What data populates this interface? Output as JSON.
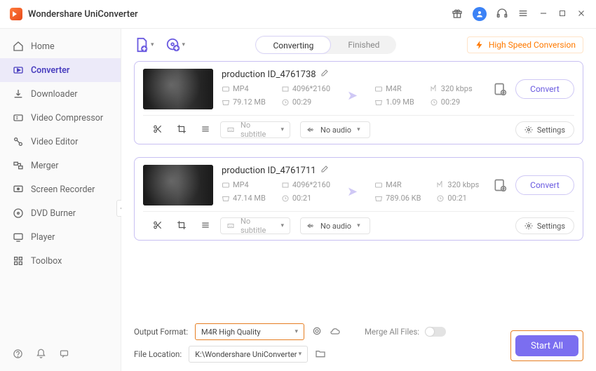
{
  "app": {
    "title": "Wondershare UniConverter"
  },
  "sidebar": {
    "items": [
      {
        "label": "Home"
      },
      {
        "label": "Converter"
      },
      {
        "label": "Downloader"
      },
      {
        "label": "Video Compressor"
      },
      {
        "label": "Video Editor"
      },
      {
        "label": "Merger"
      },
      {
        "label": "Screen Recorder"
      },
      {
        "label": "DVD Burner"
      },
      {
        "label": "Player"
      },
      {
        "label": "Toolbox"
      }
    ]
  },
  "tabs": {
    "converting": "Converting",
    "finished": "Finished"
  },
  "banner": {
    "high_speed": "High Speed Conversion"
  },
  "items": [
    {
      "name": "production ID_4761738",
      "src_fmt": "MP4",
      "src_res": "4096*2160",
      "src_size": "79.12 MB",
      "src_dur": "00:29",
      "dst_fmt": "M4R",
      "dst_kbps": "320 kbps",
      "dst_size": "1.09 MB",
      "dst_dur": "00:29",
      "subtitle": "No subtitle",
      "audio": "No audio",
      "convert_label": "Convert",
      "settings_label": "Settings"
    },
    {
      "name": "production ID_4761711",
      "src_fmt": "MP4",
      "src_res": "4096*2160",
      "src_size": "47.14 MB",
      "src_dur": "00:21",
      "dst_fmt": "M4R",
      "dst_kbps": "320 kbps",
      "dst_size": "789.06 KB",
      "dst_dur": "00:21",
      "subtitle": "No subtitle",
      "audio": "No audio",
      "convert_label": "Convert",
      "settings_label": "Settings"
    }
  ],
  "footer": {
    "output_format_label": "Output Format:",
    "output_format_value": "M4R High Quality",
    "file_location_label": "File Location:",
    "file_location_value": "K:\\Wondershare UniConverter",
    "merge_label": "Merge All Files:",
    "start_all": "Start All"
  }
}
